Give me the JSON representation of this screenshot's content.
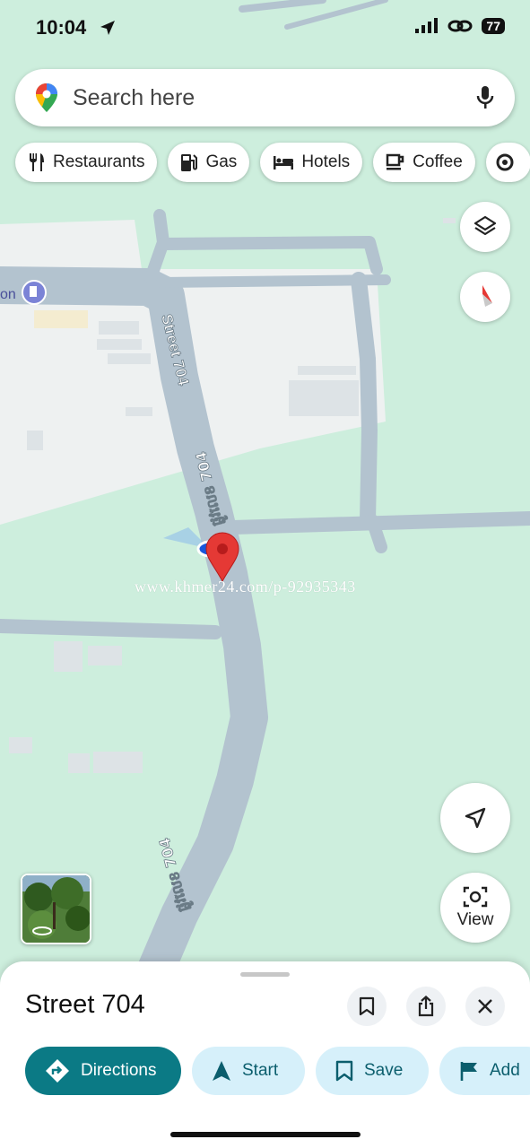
{
  "status": {
    "time": "10:04",
    "battery": "77"
  },
  "search": {
    "placeholder": "Search here"
  },
  "chips": [
    {
      "label": "Restaurants",
      "icon": "fork-knife-icon"
    },
    {
      "label": "Gas",
      "icon": "gas-pump-icon"
    },
    {
      "label": "Hotels",
      "icon": "bed-icon"
    },
    {
      "label": "Coffee",
      "icon": "coffee-cup-icon"
    }
  ],
  "map": {
    "road_label_en": "Street 704",
    "road_label_km_1": "ផ្លូវលេខ 704",
    "road_label_km_2": "ផ្លូវលេខ 704",
    "poi_fragment": "on",
    "watermark": "www.khmer24.com/p-92935343",
    "colors": {
      "land": "#cdeedd",
      "road": "#b3c3cf",
      "urban": "#eef1f1",
      "pin": "#e53935",
      "location": "#1a56db"
    }
  },
  "controls": {
    "view_label": "View"
  },
  "sheet": {
    "title": "Street 704",
    "actions": [
      {
        "label": "Directions",
        "icon": "directions-icon"
      },
      {
        "label": "Start",
        "icon": "navigation-arrow-icon"
      },
      {
        "label": "Save",
        "icon": "bookmark-icon"
      },
      {
        "label": "Add",
        "icon": "flag-icon"
      }
    ]
  }
}
